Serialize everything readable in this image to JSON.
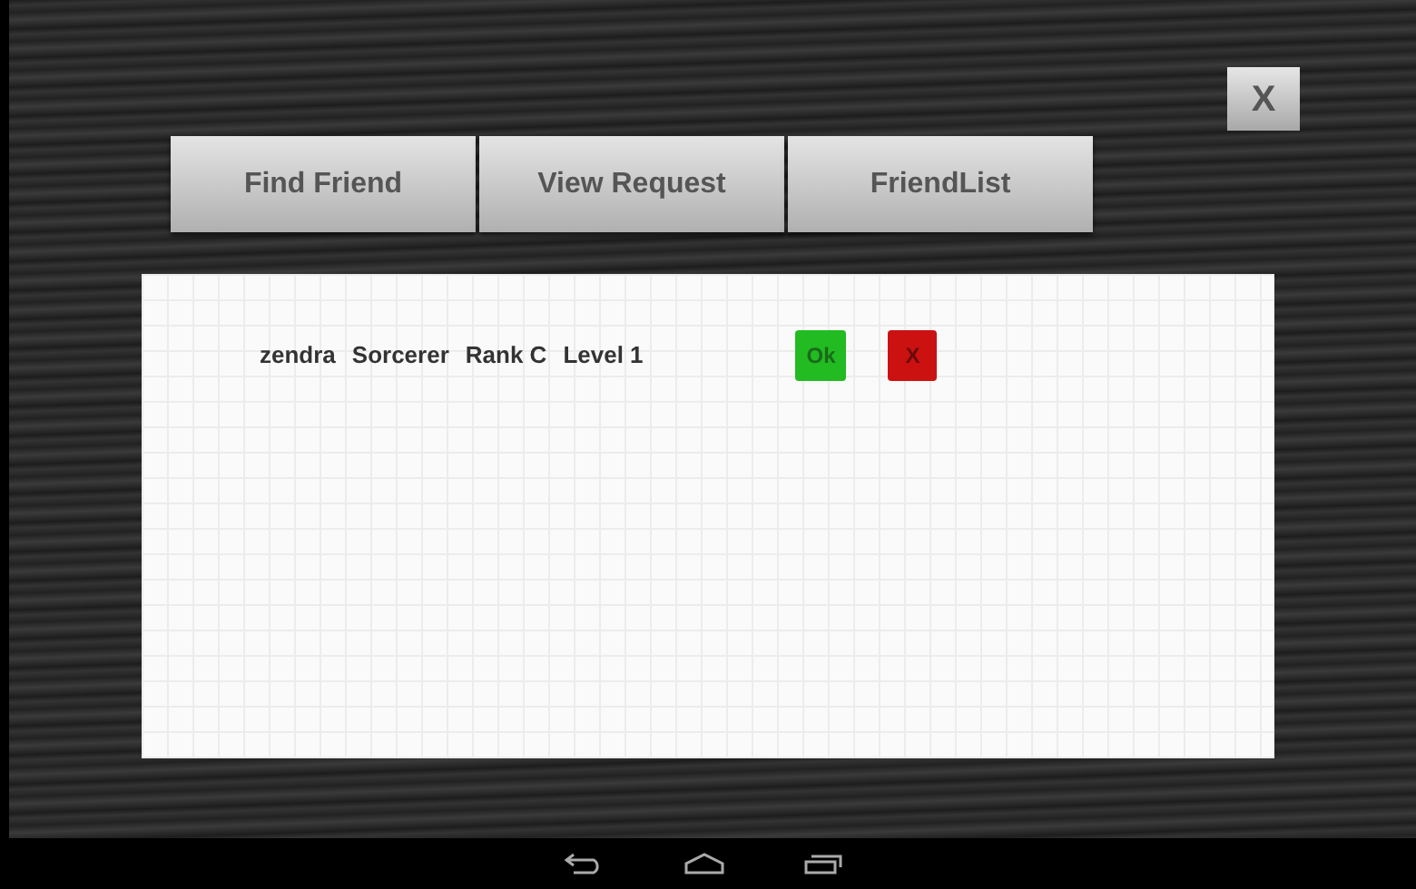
{
  "close_button": "X",
  "tabs": [
    {
      "label": "Find Friend"
    },
    {
      "label": "View Request"
    },
    {
      "label": "FriendList"
    }
  ],
  "requests": [
    {
      "name": "zendra",
      "class": "Sorcerer",
      "rank": "Rank C",
      "level": "Level 1",
      "accept": "Ok",
      "reject": "X"
    }
  ]
}
